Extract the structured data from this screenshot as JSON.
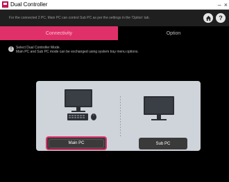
{
  "window": {
    "title": "Dual Controller",
    "minimize": "–",
    "close": "×"
  },
  "header": {
    "text": "For the connected 2 PC, Main PC can control Sub PC as per the settings in the 'Option' tab.",
    "home_icon": "home-icon",
    "help_icon": "help-icon",
    "help_glyph": "?"
  },
  "tabs": [
    {
      "label": "Connectivity",
      "active": true
    },
    {
      "label": "Option",
      "active": false
    }
  ],
  "info": {
    "glyph": "!",
    "line1": "Select Dual Controller Mode.",
    "line2": "Main PC and Sub PC mode can be exchanged using system tray menu options."
  },
  "modes": {
    "main_label": "Main PC",
    "sub_label": "Sub PC",
    "selected": "Main PC"
  },
  "colors": {
    "accent": "#e0306a",
    "panel": "#cfd3da",
    "background": "#000000",
    "header": "#1f1f1f"
  }
}
